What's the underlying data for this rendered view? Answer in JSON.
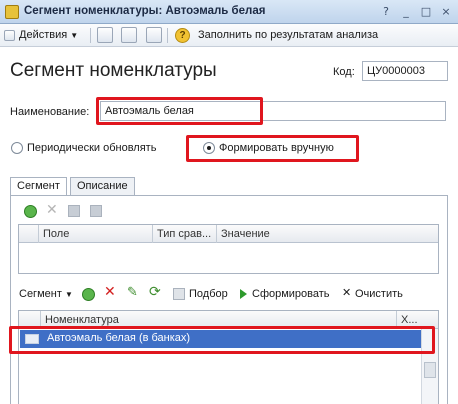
{
  "window": {
    "title": "Сегмент номенклатуры: Автоэмаль белая",
    "controls": [
      "?",
      "_",
      "□",
      "×"
    ]
  },
  "toolbar": {
    "actions_label": "Действия",
    "fill_label": "Заполнить по результатам анализа"
  },
  "form": {
    "heading": "Сегмент номенклатуры",
    "code_label": "Код:",
    "code_value": "ЦУ0000003",
    "name_label": "Наименование:",
    "name_value": "Автоэмаль белая",
    "radio_periodic": "Периодически обновлять",
    "radio_manual": "Формировать вручную",
    "selected_mode": "Формировать вручную"
  },
  "tabs": [
    {
      "label": "Сегмент",
      "active": true
    },
    {
      "label": "Описание",
      "active": false
    }
  ],
  "filter_grid": {
    "columns": [
      "Поле",
      "Тип срав...",
      "Значение"
    ]
  },
  "segment_toolbar": {
    "segment_label": "Сегмент",
    "pick_label": "Подбор",
    "generate_label": "Сформировать",
    "clear_label": "Очистить"
  },
  "nomenclature_grid": {
    "columns": [
      "Номенклатура",
      "Х..."
    ],
    "rows": [
      {
        "name": "Автоэмаль белая (в банках)"
      }
    ]
  },
  "colors": {
    "highlight": "#e0161e",
    "selection": "#3f6fc6"
  }
}
